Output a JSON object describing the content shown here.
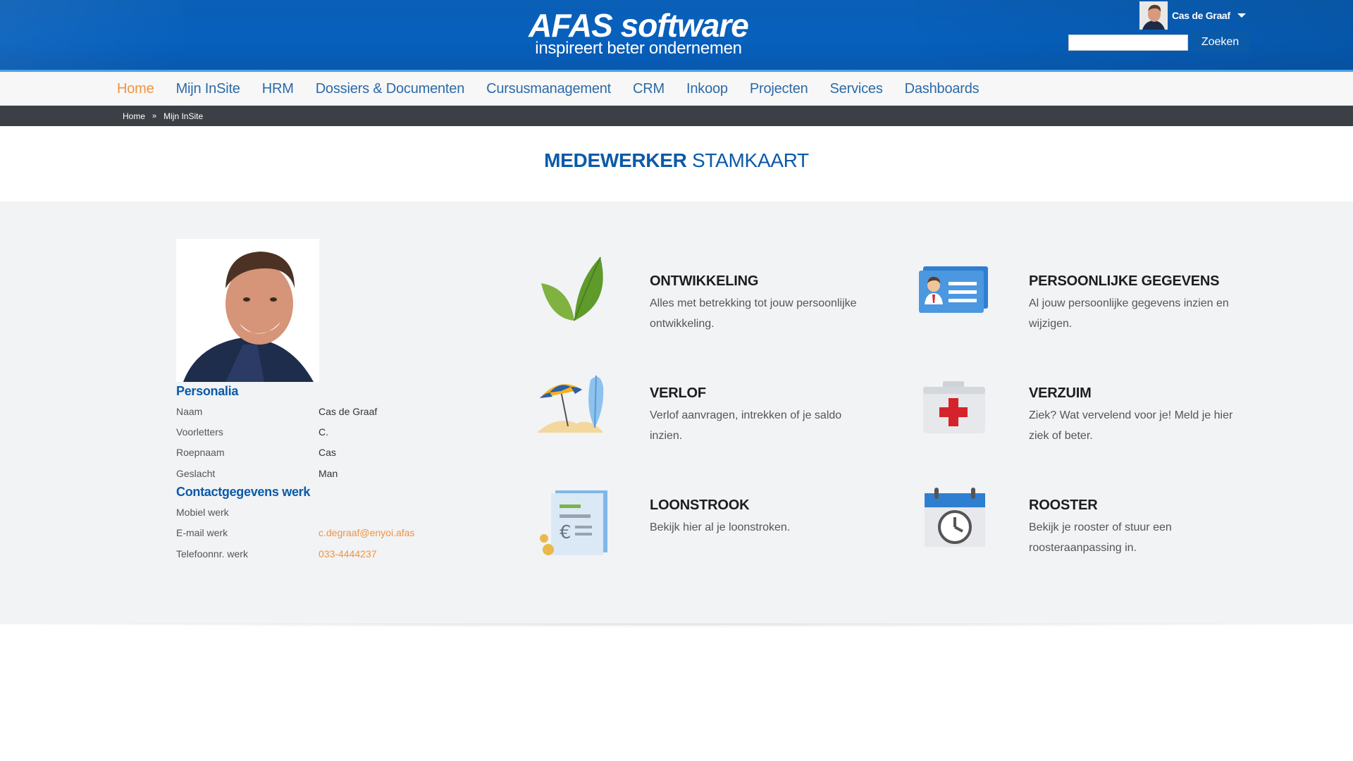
{
  "brand": {
    "name": "AFAS software",
    "tagline": "inspireert beter ondernemen"
  },
  "user": {
    "name": "Cas de Graaf"
  },
  "search": {
    "value": "",
    "button_label": "Zoeken"
  },
  "nav": {
    "items": [
      {
        "label": "Home",
        "active": true
      },
      {
        "label": "Mijn InSite"
      },
      {
        "label": "HRM"
      },
      {
        "label": "Dossiers & Documenten"
      },
      {
        "label": "Cursusmanagement"
      },
      {
        "label": "CRM"
      },
      {
        "label": "Inkoop"
      },
      {
        "label": "Projecten"
      },
      {
        "label": "Services"
      },
      {
        "label": "Dashboards"
      }
    ]
  },
  "breadcrumb": {
    "items": [
      "Home",
      "Mijn InSite"
    ],
    "separator": "»"
  },
  "page": {
    "title_bold": "MEDEWERKER",
    "title_rest": "STAMKAART"
  },
  "personalia": {
    "heading": "Personalia",
    "rows": [
      {
        "label": "Naam",
        "value": "Cas de Graaf"
      },
      {
        "label": "Voorletters",
        "value": "C."
      },
      {
        "label": "Roepnaam",
        "value": "Cas"
      },
      {
        "label": "Geslacht",
        "value": "Man"
      }
    ]
  },
  "contact": {
    "heading": "Contactgegevens werk",
    "rows": [
      {
        "label": "Mobiel werk",
        "value": ""
      },
      {
        "label": "E-mail werk",
        "value": "c.degraaf@enyoi.afas"
      },
      {
        "label": "Telefoonnr. werk",
        "value": "033-4444237"
      }
    ]
  },
  "tiles": [
    {
      "title": "ONTWIKKELING",
      "desc": "Alles met betrekking tot jouw persoonlijke ontwikkeling.",
      "icon": "leaf-icon"
    },
    {
      "title": "PERSOONLIJKE GEGEVENS",
      "desc": "Al jouw persoonlijke gegevens inzien en wijzigen.",
      "icon": "id-card-icon"
    },
    {
      "title": "VERLOF",
      "desc": "Verlof aanvragen, intrekken of je saldo inzien.",
      "icon": "beach-umbrella-icon"
    },
    {
      "title": "VERZUIM",
      "desc": "Ziek? Wat vervelend voor je! Meld je hier ziek of beter.",
      "icon": "first-aid-kit-icon"
    },
    {
      "title": "LOONSTROOK",
      "desc": "Bekijk hier al je loonstroken.",
      "icon": "payslip-euro-icon"
    },
    {
      "title": "ROOSTER",
      "desc": "Bekijk je rooster of stuur een roosteraanpassing in.",
      "icon": "calendar-clock-icon"
    }
  ],
  "colors": {
    "brand_blue": "#0660bd",
    "link_orange": "#f0943f",
    "heading_blue": "#0b5aa8",
    "breadcrumb_bg": "#3c4046",
    "content_bg": "#f1f3f5"
  }
}
